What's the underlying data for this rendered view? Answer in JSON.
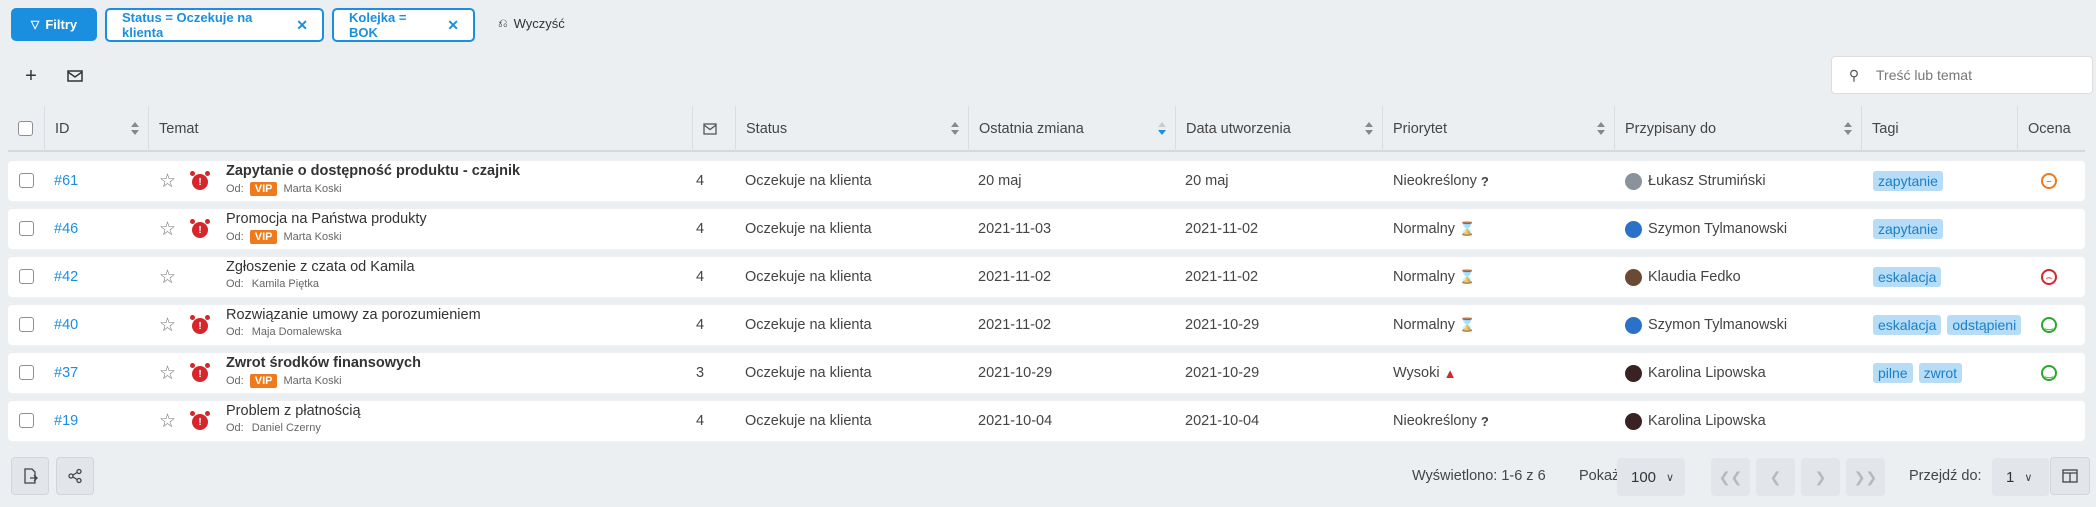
{
  "filters": {
    "button_label": "Filtry",
    "chips": [
      {
        "label": "Status = Oczekuje na klienta"
      },
      {
        "label": "Kolejka = BOK"
      }
    ],
    "clear_label": "Wyczyść"
  },
  "search": {
    "placeholder": "Treść lub temat"
  },
  "columns": {
    "id": "ID",
    "subject": "Temat",
    "status": "Status",
    "last_change": "Ostatnia zmiana",
    "created": "Data utworzenia",
    "priority": "Priorytet",
    "assigned": "Przypisany do",
    "tags": "Tagi",
    "rating": "Ocena"
  },
  "from_prefix": "Od:",
  "vip_label": "VIP",
  "rows": [
    {
      "id": "#61",
      "subject": "Zapytanie o dostępność produktu - czajnik",
      "bold": true,
      "alarm": true,
      "vip": true,
      "from": "Marta Koski",
      "count": "4",
      "status": "Oczekuje na klienta",
      "last_change": "20 maj",
      "created": "20 maj",
      "priority": "Nieokreślony",
      "priority_icon": "question-icon",
      "assigned": "Łukasz Strumiński",
      "tags": [
        "zapytanie"
      ],
      "rating": "neutral",
      "rating_color": "#ee7a1b"
    },
    {
      "id": "#46",
      "subject": "Promocja na Państwa produkty",
      "bold": false,
      "alarm": true,
      "vip": true,
      "from": "Marta Koski",
      "count": "4",
      "status": "Oczekuje na klienta",
      "last_change": "2021-11-03",
      "created": "2021-11-02",
      "priority": "Normalny",
      "priority_icon": "hourglass-icon",
      "assigned": "Szymon Tylmanowski",
      "tags": [
        "zapytanie"
      ],
      "rating": "",
      "rating_color": ""
    },
    {
      "id": "#42",
      "subject": "Zgłoszenie z czata od Kamila",
      "bold": false,
      "alarm": false,
      "vip": false,
      "from": "Kamila Piętka",
      "count": "4",
      "status": "Oczekuje na klienta",
      "last_change": "2021-11-02",
      "created": "2021-11-02",
      "priority": "Normalny",
      "priority_icon": "hourglass-icon",
      "assigned": "Klaudia Fedko",
      "tags": [
        "eskalacja"
      ],
      "rating": "sad",
      "rating_color": "#d6252b"
    },
    {
      "id": "#40",
      "subject": "Rozwiązanie umowy za porozumieniem",
      "bold": false,
      "alarm": true,
      "vip": false,
      "from": "Maja Domalewska",
      "count": "4",
      "status": "Oczekuje na klienta",
      "last_change": "2021-11-02",
      "created": "2021-10-29",
      "priority": "Normalny",
      "priority_icon": "hourglass-icon",
      "assigned": "Szymon Tylmanowski",
      "tags": [
        "eskalacja",
        "odstąpieni"
      ],
      "rating": "happy",
      "rating_color": "#2aa82e"
    },
    {
      "id": "#37",
      "subject": "Zwrot środków finansowych",
      "bold": true,
      "alarm": true,
      "vip": true,
      "from": "Marta Koski",
      "count": "3",
      "status": "Oczekuje na klienta",
      "last_change": "2021-10-29",
      "created": "2021-10-29",
      "priority": "Wysoki",
      "priority_icon": "siren-icon",
      "assigned": "Karolina Lipowska",
      "tags": [
        "pilne",
        "zwrot"
      ],
      "rating": "happy",
      "rating_color": "#2aa82e"
    },
    {
      "id": "#19",
      "subject": "Problem z płatnością",
      "bold": false,
      "alarm": true,
      "vip": false,
      "from": "Daniel Czerny",
      "count": "4",
      "status": "Oczekuje na klienta",
      "last_change": "2021-10-04",
      "created": "2021-10-04",
      "priority": "Nieokreślony",
      "priority_icon": "question-icon",
      "assigned": "Karolina Lipowska",
      "tags": [],
      "rating": "",
      "rating_color": ""
    }
  ],
  "avatar_colors": {
    "Łukasz Strumiński": "#8a939b",
    "Szymon Tylmanowski": "#2a72c9",
    "Klaudia Fedko": "#6b4a35",
    "Karolina Lipowska": "#3a2222"
  },
  "footer": {
    "shown": "Wyświetlono: 1-6 z 6",
    "show_label": "Pokaż:",
    "page_size": "100",
    "goto_label": "Przejdź do:",
    "page": "1"
  }
}
